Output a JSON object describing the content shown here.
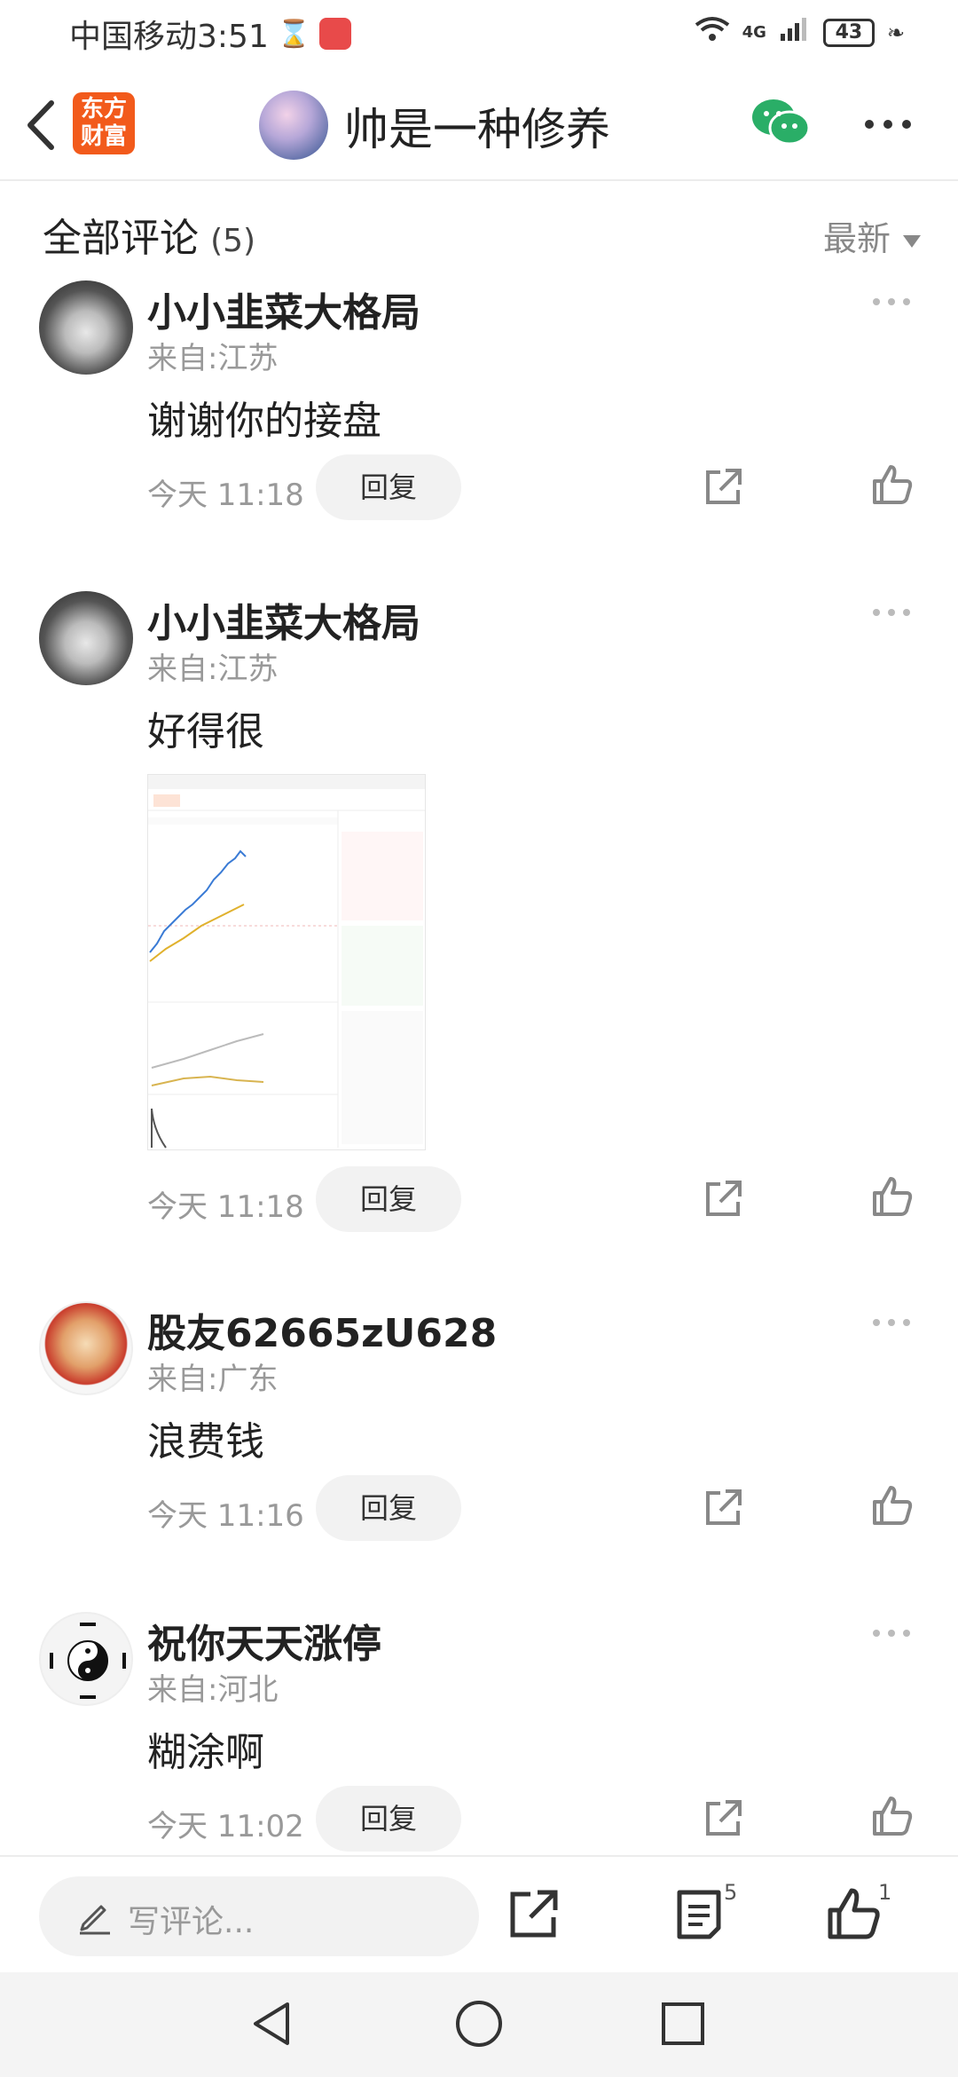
{
  "status_bar": {
    "carrier_time": "中国移动3:51",
    "network": "4G",
    "battery": "43"
  },
  "nav": {
    "logo_text": "东方财富",
    "title": "帅是一种修养"
  },
  "section": {
    "title": "全部评论",
    "count": "(5)",
    "sort": "最新"
  },
  "comments": [
    {
      "name": "小小韭菜大格局",
      "location": "来自:江苏",
      "text": "谢谢你的接盘",
      "time": "今天 11:18",
      "reply": "回复"
    },
    {
      "name": "小小韭菜大格局",
      "location": "来自:江苏",
      "text": "好得很",
      "time": "今天 11:18",
      "reply": "回复"
    },
    {
      "name": "股友62665zU628",
      "location": "来自:广东",
      "text": "浪费钱",
      "time": "今天 11:16",
      "reply": "回复"
    },
    {
      "name": "祝你天天涨停",
      "location": "来自:河北",
      "text": "糊涂啊",
      "time": "今天 11:02",
      "reply": "回复"
    }
  ],
  "bottom_bar": {
    "input_placeholder": "写评论...",
    "comment_count": "5",
    "like_count": "1"
  },
  "colors": {
    "brand": "#f25a1b",
    "wechat": "#2aae67",
    "muted": "#999999"
  }
}
